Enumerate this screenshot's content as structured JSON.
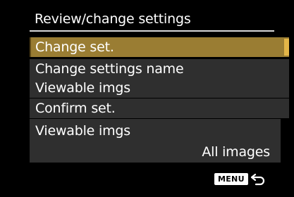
{
  "screen": {
    "title": "Review/change settings"
  },
  "menu": {
    "items": [
      {
        "label": "Change set.",
        "selected": true
      },
      {
        "label": "Change settings name",
        "selected": false
      },
      {
        "label": "Viewable imgs",
        "selected": false
      },
      {
        "label": "Confirm set.",
        "selected": false
      }
    ]
  },
  "info": {
    "label": "Viewable imgs",
    "value": "All images"
  },
  "footer": {
    "menu_key": "MENU",
    "return_icon": "return-arrow-icon"
  },
  "colors": {
    "background": "#000000",
    "item_background": "#2f2f2f",
    "selection": "#9a7d33",
    "scroll_accent": "#e3b548",
    "text": "#ffffff"
  }
}
